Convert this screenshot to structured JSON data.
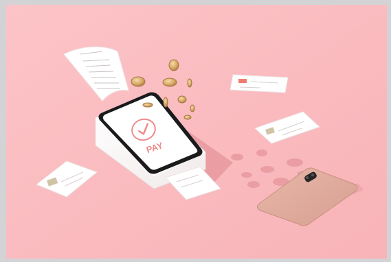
{
  "scene": {
    "background_color": "#fbbcc0",
    "frame_color": "#d3d3d6",
    "terminal": {
      "screen_text": "PAY",
      "accent_color": "#f08a8a",
      "icon": "checkmark-circle-icon"
    },
    "objects": [
      "receipt-strip",
      "payment-terminal",
      "gold-coins",
      "credit-card",
      "smartphone"
    ]
  }
}
